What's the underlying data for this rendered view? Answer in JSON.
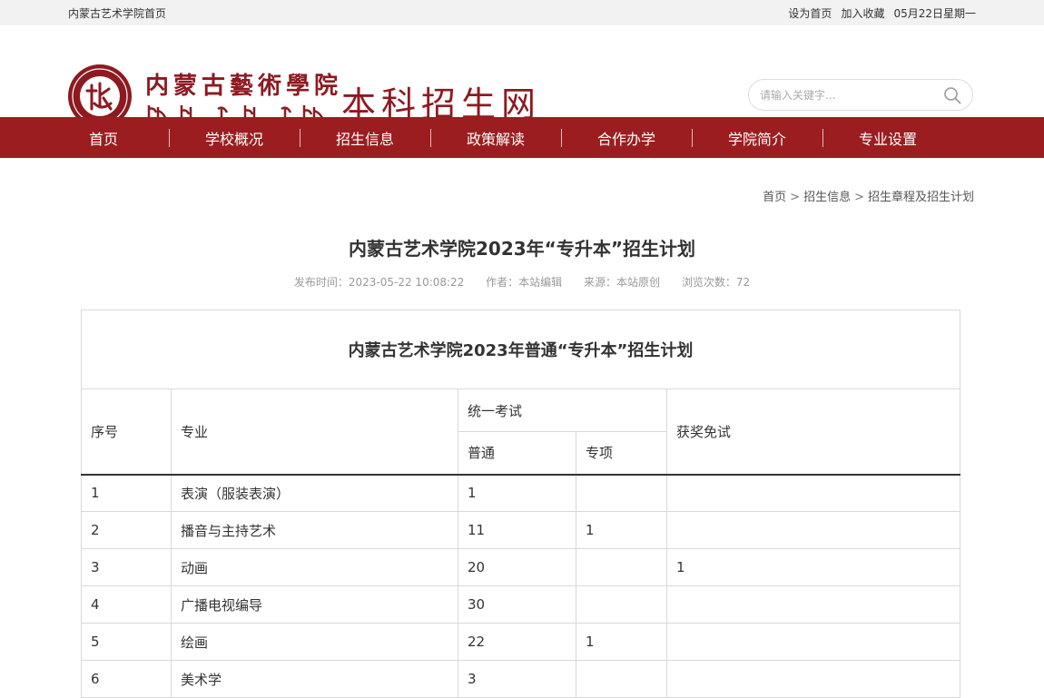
{
  "topbar": {
    "home_link": "内蒙古艺术学院首页",
    "set_home": "设为首页",
    "add_fav": "加入收藏",
    "date": "05月22日星期一"
  },
  "header": {
    "logo_cn": "内蒙古藝術學院",
    "site_name": "本科招生网",
    "search_placeholder": "请输入关键字..."
  },
  "nav": {
    "items": [
      "首页",
      "学校概况",
      "招生信息",
      "政策解读",
      "合作办学",
      "学院简介",
      "专业设置"
    ]
  },
  "breadcrumb": {
    "items": [
      "首页",
      "招生信息",
      "招生章程及招生计划"
    ],
    "sep": ">"
  },
  "article": {
    "title": "内蒙古艺术学院2023年“专升本”招生计划",
    "publish_time": "发布时间：2023-05-22 10:08:22",
    "author": "作者：本站编辑",
    "source": "来源：本站原创",
    "views": "浏览次数：72"
  },
  "table": {
    "caption": "内蒙古艺术学院2023年普通“专升本”招生计划",
    "headers": {
      "index": "序号",
      "major": "专业",
      "unified_exam": "统一考试",
      "normal": "普通",
      "special": "专项",
      "award_exempt": "获奖免试"
    },
    "rows": [
      {
        "index": "1",
        "major": "表演（服装表演）",
        "normal": "1",
        "special": "",
        "award": ""
      },
      {
        "index": "2",
        "major": "播音与主持艺术",
        "normal": "11",
        "special": "1",
        "award": ""
      },
      {
        "index": "3",
        "major": "动画",
        "normal": "20",
        "special": "",
        "award": "1"
      },
      {
        "index": "4",
        "major": "广播电视编导",
        "normal": "30",
        "special": "",
        "award": ""
      },
      {
        "index": "5",
        "major": "绘画",
        "normal": "22",
        "special": "1",
        "award": ""
      },
      {
        "index": "6",
        "major": "美术学",
        "normal": "3",
        "special": "",
        "award": ""
      }
    ]
  },
  "colors": {
    "brand_red": "#9b1d20",
    "logo_red": "#8e1a21"
  }
}
